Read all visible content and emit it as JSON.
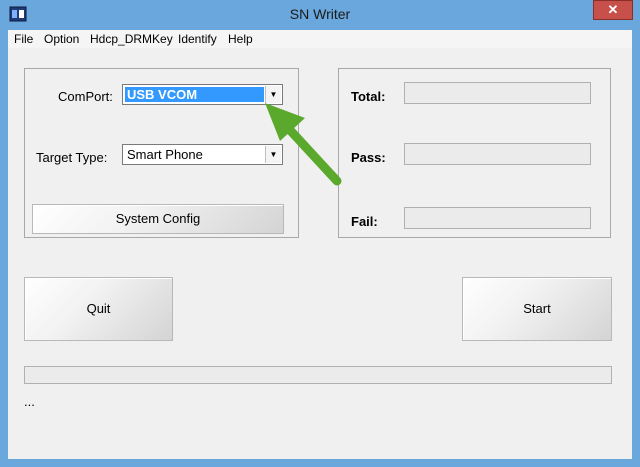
{
  "window": {
    "title": "SN Writer",
    "close_label": "✕"
  },
  "menu": {
    "items": [
      "File",
      "Option",
      "Hdcp_DRMKey",
      "Identify",
      "Help"
    ]
  },
  "config": {
    "comport_label": "ComPort:",
    "comport_value": "USB VCOM",
    "target_label": "Target Type:",
    "target_value": "Smart Phone",
    "system_config_label": "System Config"
  },
  "stats": {
    "total_label": "Total:",
    "pass_label": "Pass:",
    "fail_label": "Fail:"
  },
  "actions": {
    "quit_label": "Quit",
    "start_label": "Start"
  },
  "status": {
    "text": "..."
  },
  "colors": {
    "titlebar": "#6aa7dc",
    "selection": "#3399ff",
    "arrow": "#5aa82c",
    "close": "#c7504a"
  }
}
